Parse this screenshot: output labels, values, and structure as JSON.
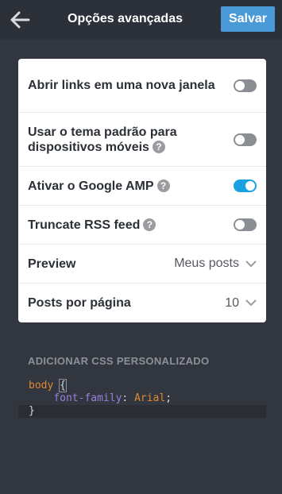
{
  "header": {
    "title": "Opções avançadas",
    "save_label": "Salvar"
  },
  "settings": {
    "open_links": {
      "label": "Abrir links em uma nova janela",
      "enabled": false
    },
    "default_theme": {
      "label": "Usar o tema padrão para dispositivos móveis",
      "help": "?",
      "enabled": false
    },
    "google_amp": {
      "label": "Ativar o Google AMP",
      "help": "?",
      "enabled": true
    },
    "truncate_rss": {
      "label": "Truncate RSS feed",
      "help": "?",
      "enabled": false
    },
    "preview": {
      "label": "Preview",
      "value": "Meus posts"
    },
    "posts_per_page": {
      "label": "Posts por página",
      "value": "10"
    }
  },
  "custom_css": {
    "section_title": "ADICIONAR CSS PERSONALIZADO",
    "selector": "body",
    "open_brace": "{",
    "property": "font-family",
    "colon": ":",
    "value": "Arial",
    "semicolon": ";",
    "close_brace": "}"
  },
  "colors": {
    "accent": "#1ba1e2",
    "save_button": "#4a9ad8",
    "background": "#32363e"
  }
}
